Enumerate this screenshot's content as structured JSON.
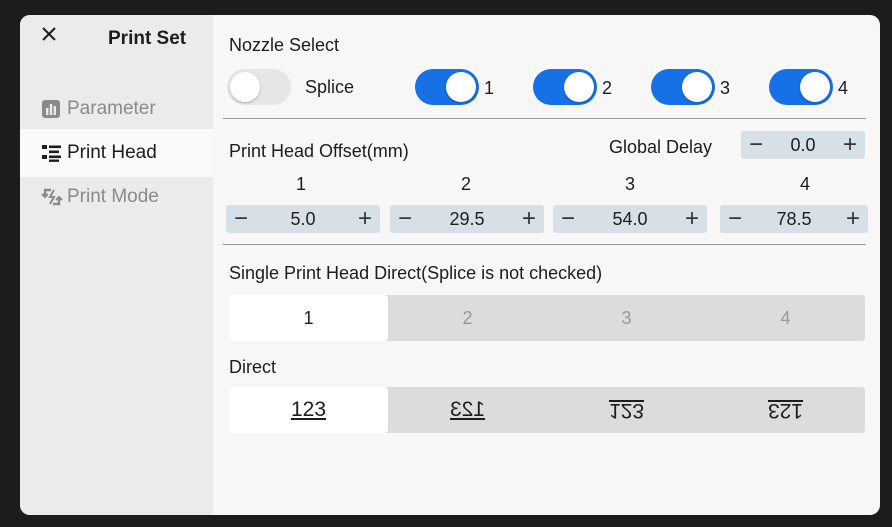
{
  "sidebar": {
    "title": "Print Set",
    "close_icon": "close-icon",
    "items": [
      {
        "label": "Parameter",
        "icon": "bar-chart-icon",
        "active": false
      },
      {
        "label": "Print Head",
        "icon": "list-icon",
        "active": true
      },
      {
        "label": "Print Mode",
        "icon": "swap-icon",
        "active": false
      }
    ]
  },
  "nozzle": {
    "title": "Nozzle Select",
    "splice_label": "Splice",
    "splice_on": false,
    "toggles": [
      {
        "label": "1",
        "on": true
      },
      {
        "label": "2",
        "on": true
      },
      {
        "label": "3",
        "on": true
      },
      {
        "label": "4",
        "on": true
      }
    ]
  },
  "offset": {
    "title": "Print Head Offset(mm)",
    "global_delay_label": "Global Delay",
    "global_delay_value": "0.0",
    "minus": "−",
    "plus": "+",
    "heads": [
      {
        "label": "1",
        "value": "5.0"
      },
      {
        "label": "2",
        "value": "29.5"
      },
      {
        "label": "3",
        "value": "54.0"
      },
      {
        "label": "4",
        "value": "78.5"
      }
    ]
  },
  "single": {
    "title": "Single Print Head Direct(Splice is not checked)",
    "options": [
      "1",
      "2",
      "3",
      "4"
    ],
    "selected": "1"
  },
  "direct": {
    "title": "Direct",
    "options": [
      "123",
      "123",
      "123",
      "123"
    ],
    "selected_index": 0
  },
  "colors": {
    "accent": "#1670e6",
    "stepper_bg": "#d6e0e6"
  }
}
